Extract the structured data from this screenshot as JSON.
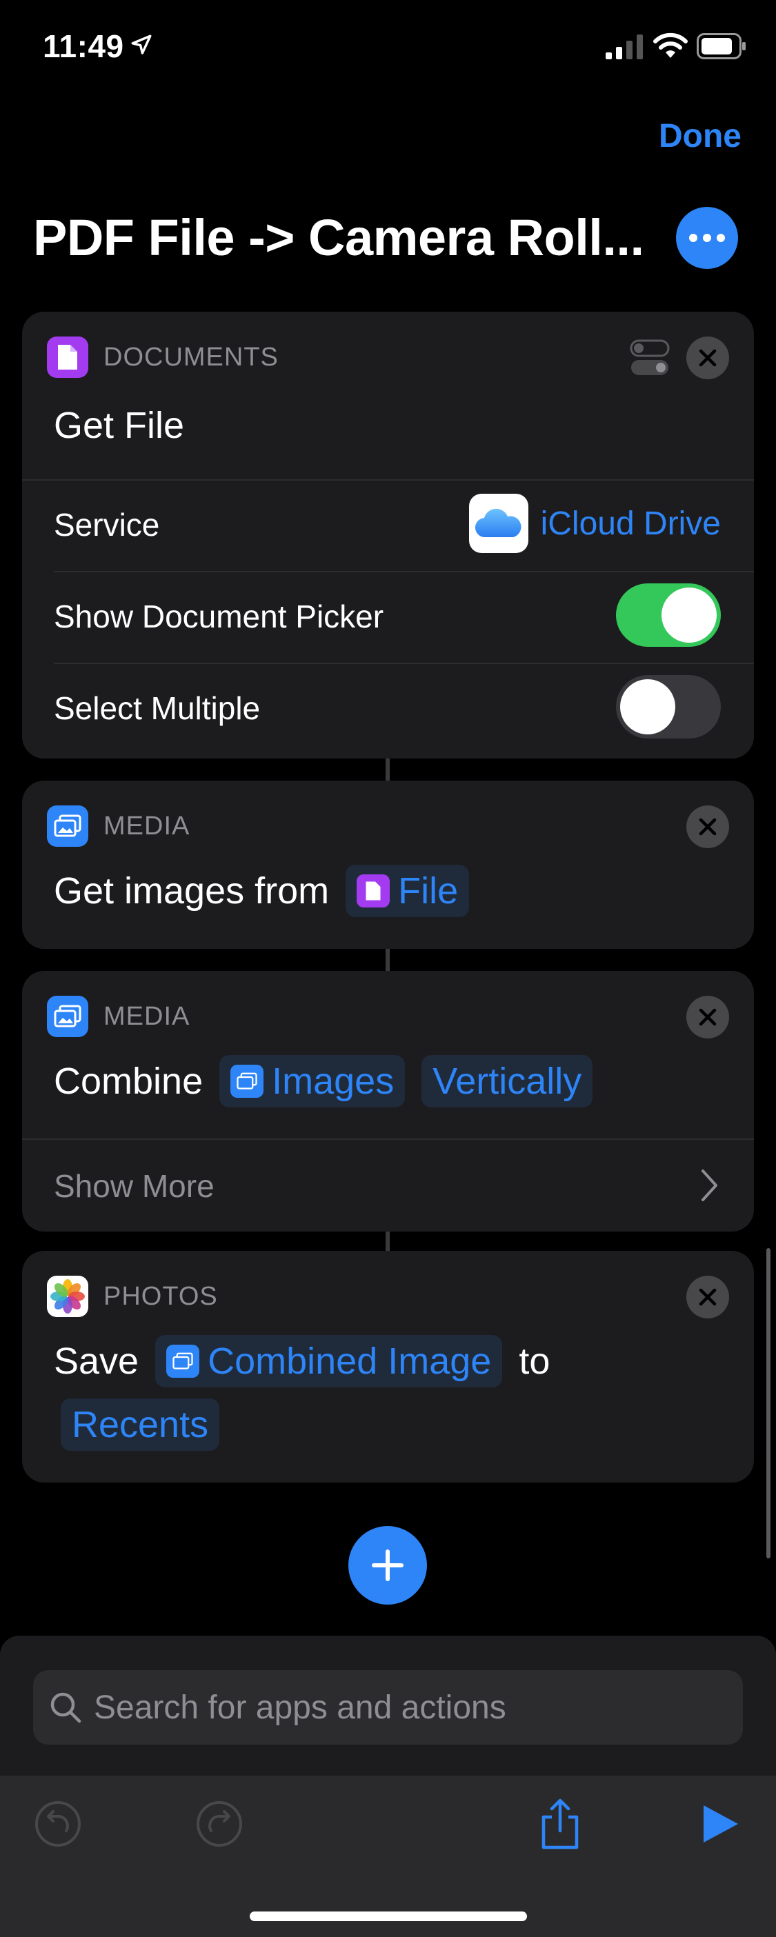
{
  "status_bar": {
    "time": "11:49"
  },
  "header": {
    "done_label": "Done",
    "title": "PDF File -> Camera Roll..."
  },
  "actions": [
    {
      "category": "DOCUMENTS",
      "title": "Get File",
      "rows": [
        {
          "label": "Service",
          "value": "iCloud Drive"
        },
        {
          "label": "Show Document Picker",
          "toggle": true
        },
        {
          "label": "Select Multiple",
          "toggle": false
        }
      ]
    },
    {
      "category": "MEDIA",
      "text": "Get images from",
      "token": "File"
    },
    {
      "category": "MEDIA",
      "text": "Combine",
      "token_images": "Images",
      "token_direction": "Vertically",
      "show_more": "Show More"
    },
    {
      "category": "PHOTOS",
      "text_save": "Save",
      "token": "Combined Image",
      "text_to": "to",
      "album": "Recents"
    }
  ],
  "search": {
    "placeholder": "Search for apps and actions"
  },
  "colors": {
    "accent": "#2e85f7",
    "toggle_on": "#34c759",
    "documents": "#a33cf0",
    "background": "#000000",
    "card": "#1c1c1e"
  },
  "icons": [
    "location-arrow-icon",
    "signal-icon",
    "wifi-icon",
    "battery-icon",
    "ellipsis-icon",
    "document-icon",
    "image-icon",
    "photos-icon",
    "icloud-icon",
    "close-icon",
    "chevron-right-icon",
    "plus-icon",
    "search-icon",
    "undo-icon",
    "redo-icon",
    "share-icon",
    "play-icon"
  ]
}
